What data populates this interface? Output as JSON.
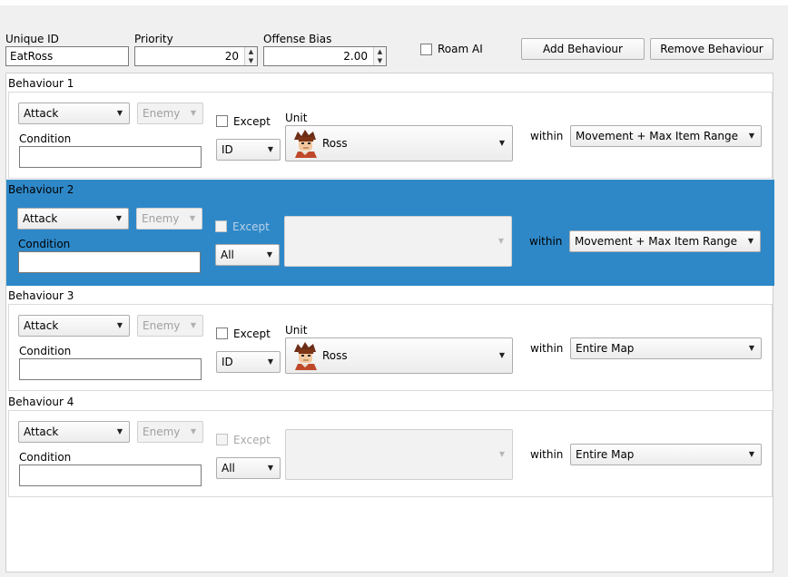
{
  "header": {
    "unique_id_label": "Unique ID",
    "unique_id_value": "EatRoss",
    "priority_label": "Priority",
    "priority_value": "20",
    "offense_bias_label": "Offense Bias",
    "offense_bias_value": "2.00",
    "roam_ai_label": "Roam AI",
    "add_button": "Add Behaviour",
    "remove_button": "Remove Behaviour"
  },
  "common": {
    "condition_label": "Condition",
    "except_label": "Except",
    "unit_label": "Unit",
    "within_label": "within"
  },
  "behaviours": [
    {
      "title": "Behaviour 1",
      "action": "Attack",
      "target": "Enemy",
      "filter": "ID",
      "unit": "Ross",
      "within": "Movement + Max Item Range",
      "selected": false
    },
    {
      "title": "Behaviour 2",
      "action": "Attack",
      "target": "Enemy",
      "filter": "All",
      "unit": "",
      "within": "Movement + Max Item Range",
      "selected": true
    },
    {
      "title": "Behaviour 3",
      "action": "Attack",
      "target": "Enemy",
      "filter": "ID",
      "unit": "Ross",
      "within": "Entire Map",
      "selected": false
    },
    {
      "title": "Behaviour 4",
      "action": "Attack",
      "target": "Enemy",
      "filter": "All",
      "unit": "",
      "within": "Entire Map",
      "selected": false
    }
  ],
  "icons": {
    "dropdown": "chevron-down-icon",
    "spin_up": "spin-up-icon",
    "spin_down": "spin-down-icon",
    "portrait": "ross-portrait-icon"
  }
}
